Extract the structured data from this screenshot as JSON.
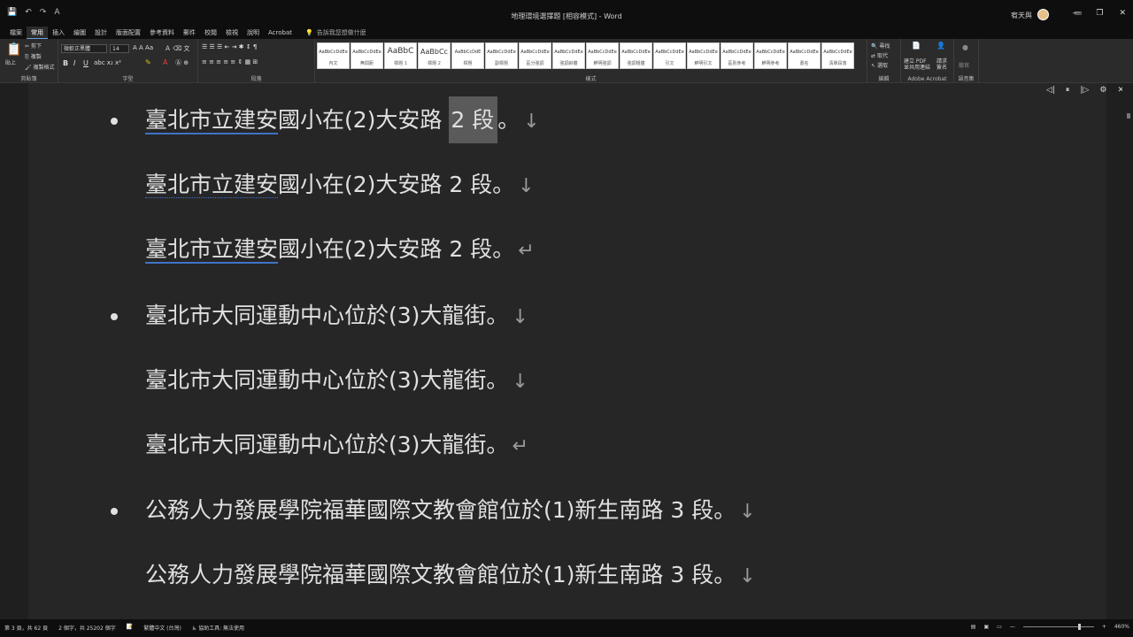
{
  "titlebar": {
    "title": "地理環境選擇題 [相容模式] - Word",
    "user": "宥天與",
    "qat": [
      "💾",
      "↶",
      "↷",
      "A"
    ],
    "window_controls": [
      "—",
      "❐",
      "✕"
    ],
    "ribbon_display_icon": "▭"
  },
  "tabs": {
    "items": [
      "檔案",
      "常用",
      "插入",
      "繪圖",
      "設計",
      "版面配置",
      "參考資料",
      "郵件",
      "校閱",
      "檢視",
      "說明",
      "Acrobat"
    ],
    "active_index": 1,
    "tell_me": "告訴我您想做什麼"
  },
  "ribbon": {
    "clipboard": {
      "paste": "貼上",
      "cut": "剪下",
      "copy": "複製",
      "format_painter": "複製格式",
      "label": "剪貼簿"
    },
    "font": {
      "name": "微軟正黑體",
      "size": "14",
      "label": "字型",
      "bold": "B",
      "italic": "I",
      "underline": "U"
    },
    "paragraph": {
      "label": "段落"
    },
    "styles": {
      "label": "樣式",
      "items": [
        {
          "sample": "AaBbCcDdEe",
          "name": "內文"
        },
        {
          "sample": "AaBbCcDdEe",
          "name": "無間距"
        },
        {
          "sample": "AaBbC",
          "name": "標題 1"
        },
        {
          "sample": "AaBbCc",
          "name": "標題 2"
        },
        {
          "sample": "AaBbCcDdE",
          "name": "標題"
        },
        {
          "sample": "AaBbCcDdEe",
          "name": "副標題"
        },
        {
          "sample": "AaBbCcDdEe",
          "name": "區分強調"
        },
        {
          "sample": "AaBbCcDdEe",
          "name": "強調斜體"
        },
        {
          "sample": "AaBbCcDdEe",
          "name": "鮮明強調"
        },
        {
          "sample": "AaBbCcDdEe",
          "name": "強調粗體"
        },
        {
          "sample": "AaBbCcDdEe",
          "name": "引文"
        },
        {
          "sample": "AaBbCcDdEe",
          "name": "鮮明引文"
        },
        {
          "sample": "AaBbCcDdEe",
          "name": "區別參考"
        },
        {
          "sample": "AaBbCcDdEe",
          "name": "鮮明參考"
        },
        {
          "sample": "AaBbCcDdEe",
          "name": "書名"
        },
        {
          "sample": "AaBbCcDdEe",
          "name": "清單段落"
        }
      ]
    },
    "editing": {
      "find": "尋找",
      "replace": "取代",
      "select": "選取",
      "label": "編輯"
    },
    "acrobat": {
      "create_pdf": "建立 PDF",
      "create_pdf2": "並共用連結",
      "request": "請求",
      "request2": "簽名",
      "label": "Adobe Acrobat"
    },
    "voice": {
      "label": "聽寫",
      "label2": "語音集"
    }
  },
  "document": {
    "lines": [
      {
        "bullet": true,
        "pre": "臺北市立建安",
        "mid": "國小在(2)大安路 ",
        "sel": "2 段",
        "post": "。",
        "mark": "↓",
        "underline": "blue"
      },
      {
        "bullet": false,
        "pre": "臺北市立建安",
        "mid": "國小在(2)大安路 ",
        "sel": "",
        "post": "2 段。",
        "mark": "↓",
        "underline": "dot"
      },
      {
        "bullet": false,
        "pre": "臺北市立建安",
        "mid": "國小在(2)大安路 ",
        "sel": "",
        "post": "2 段。",
        "mark": "↵",
        "underline": "blue"
      },
      {
        "bullet": true,
        "pre": "",
        "mid": "臺北市大同運動中心位於(3)大龍街",
        "sel": "",
        "post": "。",
        "mark": "↓",
        "underline": "none"
      },
      {
        "bullet": false,
        "pre": "",
        "mid": "臺北市大同運動中心位於(3)大龍街",
        "sel": "",
        "post": "。",
        "mark": "↓",
        "underline": "none"
      },
      {
        "bullet": false,
        "pre": "",
        "mid": "臺北市大同運動中心位於(3)大龍街",
        "sel": "",
        "post": "。",
        "mark": "↵",
        "underline": "none"
      },
      {
        "bullet": true,
        "pre": "",
        "mid": "公務人力發展學院福華國際文教會館位於(1)新生南路 3 段",
        "sel": "",
        "post": "。",
        "mark": "↓",
        "underline": "none"
      },
      {
        "bullet": false,
        "pre": "",
        "mid": "公務人力發展學院福華國際文教會館位於(1)新生南路 3 段",
        "sel": "",
        "post": "。",
        "mark": "↓",
        "underline": "none"
      }
    ],
    "read_tools": [
      "◁|",
      "⏸",
      "|▷",
      "⚙",
      "✕"
    ]
  },
  "status": {
    "page": "第 3 頁，共 62 頁",
    "words": "2 個字，共 25202 個字",
    "language": "繁體中文 (台灣)",
    "accessibility": "協助工具: 無法使用",
    "zoom": "460%",
    "zoom_fraction": 0.78
  }
}
